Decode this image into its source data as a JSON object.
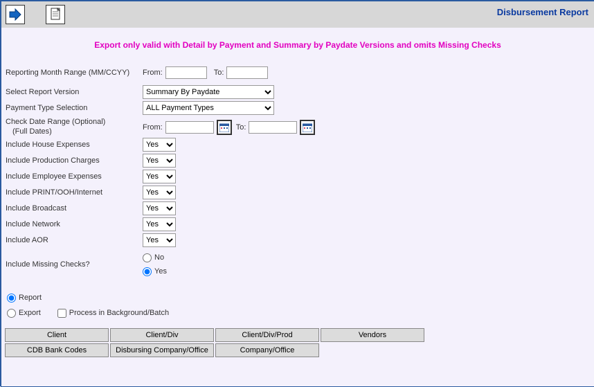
{
  "header": {
    "title": "Disbursement Report"
  },
  "notice": "Export only valid with Detail by Payment and Summary by Paydate Versions and omits Missing Checks",
  "labels": {
    "reporting_month_range": "Reporting Month Range (MM/CCYY)",
    "from": "From:",
    "to": "To:",
    "select_report_version": "Select Report Version",
    "payment_type_selection": "Payment Type Selection",
    "check_date_range": "Check Date Range (Optional)",
    "check_date_range_sub": "(Full Dates)",
    "include_house_expenses": "Include House Expenses",
    "include_production_charges": "Include Production Charges",
    "include_employee_expenses": "Include Employee Expenses",
    "include_print_ooh_internet": "Include PRINT/OOH/Internet",
    "include_broadcast": "Include Broadcast",
    "include_network": "Include Network",
    "include_aor": "Include AOR",
    "include_missing_checks": "Include Missing Checks?",
    "no": "No",
    "yes": "Yes",
    "report": "Report",
    "export": "Export",
    "process_bg": "Process in Background/Batch"
  },
  "values": {
    "reporting_from": "",
    "reporting_to": "",
    "report_version": "Summary By Paydate",
    "payment_type": "ALL Payment Types",
    "check_from": "",
    "check_to": "",
    "include_house_expenses": "Yes",
    "include_production_charges": "Yes",
    "include_employee_expenses": "Yes",
    "include_print_ooh_internet": "Yes",
    "include_broadcast": "Yes",
    "include_network": "Yes",
    "include_aor": "Yes"
  },
  "buttons": {
    "client": "Client",
    "client_div": "Client/Div",
    "client_div_prod": "Client/Div/Prod",
    "vendors": "Vendors",
    "cdb_bank_codes": "CDB Bank Codes",
    "disbursing_company_office": "Disbursing Company/Office",
    "company_office": "Company/Office"
  }
}
